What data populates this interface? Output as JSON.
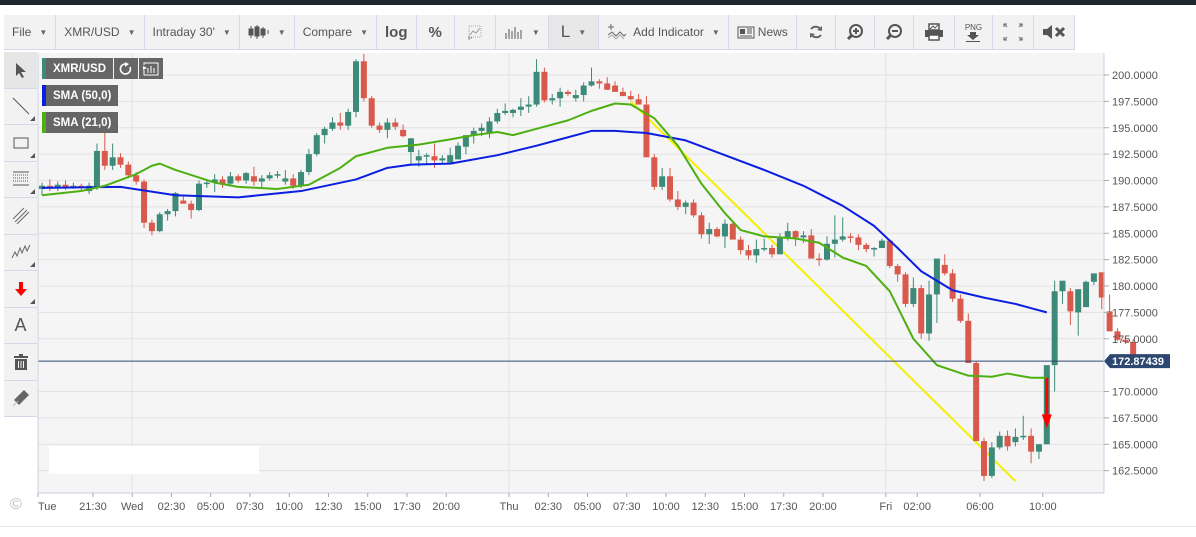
{
  "toolbar": {
    "file": "File",
    "symbol": "XMR/USD",
    "interval": "Intraday 30'",
    "chart_type_icon": "candlestick-icon",
    "compare": "Compare",
    "log": "log",
    "percent": "%",
    "drawing_icon": "chart-area-icon",
    "volume_icon": "volume-bars-icon",
    "line_style": "L",
    "add_indicator": "Add Indicator",
    "news": "News",
    "refresh_icon": "refresh-icon",
    "zoom_in_icon": "zoom-in-icon",
    "zoom_out_icon": "zoom-out-icon",
    "print_icon": "print-icon",
    "png_label": "PNG",
    "fullscreen_icon": "fullscreen-icon",
    "mute_icon": "mute-icon"
  },
  "sidebar": {
    "tools": [
      "pointer-icon",
      "line-tool-icon",
      "rectangle-tool-icon",
      "fibonacci-tool-icon",
      "parallel-channel-icon",
      "pattern-tool-icon",
      "arrow-down-tool-icon",
      "text-tool-icon",
      "trash-icon",
      "eraser-icon"
    ],
    "text_tool_label": "A"
  },
  "legend": {
    "symbol": "XMR/USD",
    "symbol_color": "#3d8a78",
    "indicators": [
      {
        "label": "SMA (50,0)",
        "color": "#0a1fe0"
      },
      {
        "label": "SMA (21,0)",
        "color": "#4db010"
      }
    ]
  },
  "copyright": "©",
  "chart_data": {
    "type": "candlestick",
    "title": "XMR/USD",
    "interval": "30 min",
    "last_price": "172.87439",
    "last_price_value": 172.87439,
    "ylim": [
      161.5,
      202.0
    ],
    "yticks": [
      "200.0000",
      "197.5000",
      "195.0000",
      "192.5000",
      "190.0000",
      "187.5000",
      "185.0000",
      "182.5000",
      "180.0000",
      "177.5000",
      "175.0000",
      "170.0000",
      "167.5000",
      "165.0000",
      "162.5000"
    ],
    "ytick_values": [
      200,
      197.5,
      195,
      192.5,
      190,
      187.5,
      185,
      182.5,
      180,
      177.5,
      175,
      170,
      167.5,
      165,
      162.5
    ],
    "xticks": [
      {
        "label": "Tue",
        "i": 0
      },
      {
        "label": "21:30",
        "i": 7
      },
      {
        "label": "Wed",
        "i": 12
      },
      {
        "label": "02:30",
        "i": 17
      },
      {
        "label": "05:00",
        "i": 22
      },
      {
        "label": "07:30",
        "i": 27
      },
      {
        "label": "10:00",
        "i": 32
      },
      {
        "label": "12:30",
        "i": 37
      },
      {
        "label": "15:00",
        "i": 42
      },
      {
        "label": "17:30",
        "i": 47
      },
      {
        "label": "20:00",
        "i": 52
      },
      {
        "label": "Thu",
        "i": 60
      },
      {
        "label": "02:30",
        "i": 65
      },
      {
        "label": "05:00",
        "i": 70
      },
      {
        "label": "07:30",
        "i": 75
      },
      {
        "label": "10:00",
        "i": 80
      },
      {
        "label": "12:30",
        "i": 85
      },
      {
        "label": "15:00",
        "i": 90
      },
      {
        "label": "17:30",
        "i": 95
      },
      {
        "label": "20:00",
        "i": 100
      },
      {
        "label": "Fri",
        "i": 108
      },
      {
        "label": "02:00",
        "i": 112
      },
      {
        "label": "06:00",
        "i": 120
      },
      {
        "label": "10:00",
        "i": 128
      }
    ],
    "colors": {
      "up": "#3d8a78",
      "down": "#d9594c",
      "sma50": "#0a1fe0",
      "sma21": "#4db010",
      "trendline": "#f5f000",
      "price_line": "#2c4770",
      "arrow": "#ff0000"
    },
    "candles": [
      [
        189.2,
        189.8,
        188.6,
        189.5
      ],
      [
        189.5,
        190.1,
        189.0,
        189.3
      ],
      [
        189.3,
        189.9,
        189.0,
        189.6
      ],
      [
        189.6,
        190.0,
        189.1,
        189.4
      ],
      [
        189.4,
        189.8,
        189.2,
        189.5
      ],
      [
        189.5,
        189.7,
        189.1,
        189.3
      ],
      [
        189.0,
        189.8,
        188.7,
        189.5
      ],
      [
        189.3,
        193.5,
        189.1,
        192.8
      ],
      [
        192.8,
        194.5,
        191.0,
        191.4
      ],
      [
        191.4,
        193.5,
        191.0,
        192.2
      ],
      [
        192.2,
        192.6,
        191.2,
        191.5
      ],
      [
        191.5,
        191.8,
        190.2,
        190.5
      ],
      [
        190.5,
        190.8,
        189.6,
        189.9
      ],
      [
        189.9,
        190.1,
        185.5,
        186.0
      ],
      [
        186.0,
        186.3,
        184.8,
        185.2
      ],
      [
        185.2,
        187.0,
        185.1,
        186.8
      ],
      [
        186.8,
        187.3,
        186.2,
        187.1
      ],
      [
        187.1,
        188.9,
        186.6,
        188.8
      ],
      [
        188.1,
        188.6,
        187.9,
        187.8
      ],
      [
        187.8,
        188.1,
        186.4,
        187.2
      ],
      [
        187.2,
        190.0,
        187.1,
        189.7
      ],
      [
        189.7,
        190.0,
        189.3,
        189.8
      ],
      [
        189.8,
        190.6,
        188.9,
        190.1
      ],
      [
        190.1,
        190.4,
        189.3,
        189.7
      ],
      [
        189.7,
        190.8,
        189.5,
        190.4
      ],
      [
        190.4,
        190.6,
        189.8,
        190.0
      ],
      [
        190.0,
        190.8,
        189.7,
        190.7
      ],
      [
        190.4,
        191.3,
        189.5,
        189.9
      ],
      [
        189.9,
        190.5,
        189.3,
        190.2
      ],
      [
        190.2,
        190.8,
        190.0,
        190.5
      ],
      [
        190.5,
        190.9,
        190.2,
        190.6
      ],
      [
        189.9,
        191.0,
        189.6,
        190.2
      ],
      [
        190.2,
        190.6,
        189.2,
        189.5
      ],
      [
        189.5,
        191.0,
        189.3,
        190.8
      ],
      [
        190.8,
        193.0,
        190.5,
        192.5
      ],
      [
        192.5,
        194.5,
        192.3,
        194.3
      ],
      [
        194.3,
        195.1,
        193.5,
        194.9
      ],
      [
        194.9,
        196.0,
        194.7,
        195.5
      ],
      [
        195.5,
        196.4,
        194.8,
        195.2
      ],
      [
        195.2,
        196.8,
        194.8,
        196.5
      ],
      [
        196.5,
        201.5,
        196.0,
        201.3
      ],
      [
        201.3,
        202.0,
        197.5,
        197.8
      ],
      [
        197.8,
        198.0,
        195.0,
        195.2
      ],
      [
        195.2,
        195.5,
        194.5,
        194.8
      ],
      [
        194.8,
        195.9,
        194.0,
        195.5
      ],
      [
        195.5,
        195.9,
        194.8,
        195.1
      ],
      [
        194.8,
        195.3,
        194.1,
        194.2
      ],
      [
        192.7,
        194.0,
        191.5,
        194.0
      ],
      [
        191.9,
        192.9,
        191.3,
        192.3
      ],
      [
        192.3,
        192.6,
        191.5,
        192.4
      ],
      [
        192.3,
        193.5,
        191.2,
        191.9
      ],
      [
        191.9,
        192.4,
        191.5,
        192.1
      ],
      [
        191.7,
        193.1,
        191.6,
        192.4
      ],
      [
        192.0,
        193.6,
        192.2,
        193.3
      ],
      [
        193.2,
        194.2,
        192.5,
        194.3
      ],
      [
        194.3,
        195.0,
        193.5,
        194.7
      ],
      [
        194.7,
        195.4,
        194.2,
        195.0
      ],
      [
        194.5,
        196.0,
        194.0,
        195.6
      ],
      [
        195.6,
        196.8,
        195.4,
        196.4
      ],
      [
        196.4,
        197.3,
        196.2,
        196.6
      ],
      [
        196.4,
        196.8,
        196.0,
        196.7
      ],
      [
        196.7,
        197.8,
        196.1,
        197.0
      ],
      [
        197.0,
        198.0,
        196.4,
        197.2
      ],
      [
        197.2,
        201.5,
        197.0,
        200.3
      ],
      [
        200.3,
        200.7,
        197.4,
        197.6
      ],
      [
        197.6,
        198.2,
        197.2,
        197.8
      ],
      [
        197.8,
        198.8,
        197.0,
        198.4
      ],
      [
        198.4,
        198.6,
        198.0,
        198.2
      ],
      [
        197.8,
        198.6,
        197.5,
        198.1
      ],
      [
        198.1,
        199.3,
        197.5,
        199.0
      ],
      [
        199.0,
        200.7,
        198.9,
        199.4
      ],
      [
        199.4,
        199.6,
        198.7,
        199.2
      ],
      [
        199.2,
        199.8,
        198.6,
        198.6
      ],
      [
        199.0,
        199.4,
        198.4,
        198.4
      ],
      [
        198.4,
        198.8,
        198.0,
        198.0
      ],
      [
        198.0,
        198.5,
        197.6,
        197.7
      ],
      [
        197.7,
        198.2,
        197.3,
        197.2
      ],
      [
        197.2,
        198.0,
        196.0,
        192.2
      ],
      [
        192.2,
        192.5,
        189.1,
        189.4
      ],
      [
        189.4,
        191.2,
        189.1,
        190.4
      ],
      [
        190.4,
        191.2,
        188.0,
        188.2
      ],
      [
        188.2,
        189.0,
        187.2,
        187.5
      ],
      [
        187.5,
        188.1,
        186.8,
        187.9
      ],
      [
        187.9,
        188.2,
        186.5,
        186.7
      ],
      [
        186.7,
        187.0,
        184.5,
        184.9
      ],
      [
        184.9,
        186.0,
        184.0,
        185.4
      ],
      [
        185.4,
        185.6,
        184.6,
        184.7
      ],
      [
        184.7,
        186.3,
        183.6,
        185.9
      ],
      [
        185.9,
        186.1,
        184.4,
        184.4
      ],
      [
        184.4,
        184.7,
        183.0,
        183.4
      ],
      [
        183.4,
        183.9,
        182.5,
        182.9
      ],
      [
        182.9,
        184.4,
        182.2,
        183.5
      ],
      [
        183.5,
        184.5,
        183.3,
        183.6
      ],
      [
        183.6,
        183.9,
        182.7,
        183.0
      ],
      [
        183.0,
        185.0,
        183.8,
        184.6
      ],
      [
        184.6,
        186.0,
        184.3,
        185.2
      ],
      [
        185.2,
        185.3,
        183.8,
        184.6
      ],
      [
        184.6,
        185.2,
        184.1,
        184.8
      ],
      [
        184.8,
        185.4,
        182.7,
        182.6
      ],
      [
        182.6,
        183.1,
        181.9,
        182.5
      ],
      [
        182.5,
        184.7,
        182.4,
        184.0
      ],
      [
        184.0,
        186.7,
        182.7,
        184.4
      ],
      [
        184.4,
        186.5,
        184.2,
        184.7
      ],
      [
        184.7,
        185.0,
        184.1,
        184.6
      ],
      [
        184.6,
        184.9,
        183.4,
        183.9
      ],
      [
        183.9,
        184.1,
        183.2,
        183.5
      ],
      [
        183.5,
        183.7,
        182.8,
        183.6
      ],
      [
        183.6,
        184.5,
        183.6,
        184.3
      ],
      [
        184.3,
        184.4,
        181.7,
        181.9
      ],
      [
        181.9,
        182.1,
        180.4,
        181.1
      ],
      [
        181.1,
        181.3,
        178.0,
        178.3
      ],
      [
        178.3,
        180.8,
        178.0,
        179.8
      ],
      [
        179.8,
        180.1,
        175.0,
        175.5
      ],
      [
        175.5,
        180.5,
        174.8,
        179.2
      ],
      [
        179.2,
        182.5,
        176.5,
        182.6
      ],
      [
        182.0,
        183.0,
        181.0,
        181.2
      ],
      [
        181.2,
        181.6,
        178.5,
        178.8
      ],
      [
        178.8,
        179.2,
        176.5,
        176.7
      ],
      [
        176.7,
        177.4,
        172.8,
        172.7
      ],
      [
        172.7,
        172.9,
        165.3,
        165.3
      ],
      [
        165.3,
        165.6,
        161.5,
        162.0
      ],
      [
        162.0,
        165.2,
        161.8,
        164.7
      ],
      [
        164.7,
        166.2,
        164.5,
        165.8
      ],
      [
        165.8,
        166.3,
        164.4,
        164.8
      ],
      [
        165.2,
        166.5,
        164.8,
        165.7
      ],
      [
        165.7,
        167.7,
        165.4,
        165.8
      ],
      [
        165.8,
        166.5,
        163.2,
        164.3
      ],
      [
        164.3,
        165.0,
        163.6,
        165.0
      ],
      [
        165.0,
        170.4,
        165.0,
        172.5
      ],
      [
        172.5,
        180.5,
        170.0,
        179.5
      ],
      [
        179.5,
        179.9,
        178.3,
        180.5
      ],
      [
        179.5,
        179.8,
        176.3,
        177.6
      ],
      [
        177.5,
        179.6,
        175.3,
        179.7
      ],
      [
        178.0,
        180.5,
        178.4,
        180.4
      ],
      [
        180.4,
        181.0,
        180.1,
        181.2
      ],
      [
        181.3,
        180.6,
        177.8,
        178.9
      ],
      [
        177.6,
        179.2,
        177.4,
        175.7
      ],
      [
        175.7,
        176.0,
        174.8,
        174.9
      ],
      [
        174.9,
        175.2,
        174.5,
        174.7
      ],
      [
        174.7,
        175.0,
        172.6,
        172.9
      ]
    ],
    "sma50": [
      [
        0,
        189.3
      ],
      [
        10,
        189.4
      ],
      [
        17,
        188.6
      ],
      [
        25,
        188.4
      ],
      [
        33,
        189.0
      ],
      [
        40,
        190.1
      ],
      [
        44,
        191.2
      ],
      [
        47,
        191.5
      ],
      [
        52,
        191.6
      ],
      [
        58,
        192.4
      ],
      [
        63,
        193.3
      ],
      [
        66,
        193.9
      ],
      [
        70,
        194.7
      ],
      [
        73,
        194.7
      ],
      [
        77,
        194.5
      ],
      [
        82,
        193.8
      ],
      [
        87,
        192.4
      ],
      [
        92,
        191.0
      ],
      [
        97,
        189.5
      ],
      [
        102,
        187.6
      ],
      [
        106,
        185.7
      ],
      [
        109,
        183.6
      ],
      [
        112,
        181.4
      ],
      [
        116,
        179.6
      ],
      [
        120,
        178.9
      ],
      [
        124,
        178.3
      ],
      [
        126,
        177.9
      ],
      [
        128,
        177.5
      ]
    ],
    "sma21": [
      [
        0,
        188.6
      ],
      [
        5,
        189.0
      ],
      [
        8,
        189.5
      ],
      [
        12,
        190.6
      ],
      [
        14,
        191.4
      ],
      [
        15,
        191.6
      ],
      [
        17,
        191.0
      ],
      [
        22,
        189.8
      ],
      [
        25,
        189.4
      ],
      [
        30,
        189.2
      ],
      [
        34,
        189.6
      ],
      [
        38,
        191.2
      ],
      [
        40,
        192.3
      ],
      [
        44,
        193.1
      ],
      [
        48,
        193.4
      ],
      [
        52,
        193.9
      ],
      [
        55,
        194.3
      ],
      [
        58,
        194.6
      ],
      [
        60,
        194.3
      ],
      [
        63,
        194.9
      ],
      [
        67,
        195.7
      ],
      [
        70,
        196.6
      ],
      [
        73,
        197.3
      ],
      [
        75,
        197.2
      ],
      [
        78,
        195.9
      ],
      [
        81,
        193.3
      ],
      [
        84,
        189.7
      ],
      [
        87,
        186.9
      ],
      [
        89,
        185.3
      ],
      [
        92,
        184.7
      ],
      [
        96,
        184.5
      ],
      [
        99,
        184.1
      ],
      [
        102,
        182.7
      ],
      [
        105,
        181.9
      ],
      [
        108,
        179.5
      ],
      [
        111,
        175.0
      ],
      [
        114,
        172.5
      ],
      [
        116,
        172.0
      ],
      [
        118,
        171.5
      ],
      [
        121,
        171.4
      ],
      [
        123,
        171.7
      ],
      [
        126,
        171.3
      ],
      [
        128,
        171.3
      ]
    ],
    "trendline": {
      "from": [
        75,
        197.5
      ],
      "to": [
        124,
        161.5
      ]
    },
    "annotation_arrow": {
      "i": 128,
      "from": 171.3,
      "to": 166.5
    }
  }
}
